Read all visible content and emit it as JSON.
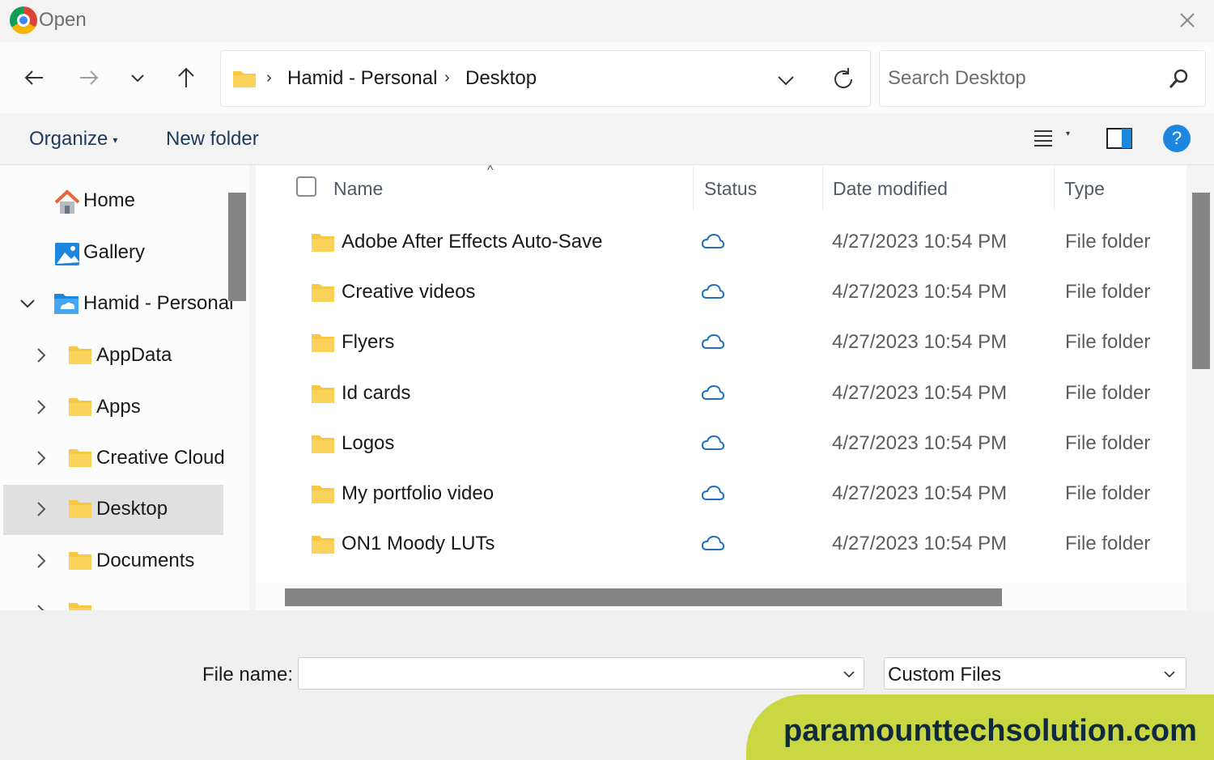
{
  "window": {
    "title": "Open"
  },
  "address": {
    "crumbs": [
      "Hamid - Personal",
      "Desktop"
    ]
  },
  "search": {
    "placeholder": "Search Desktop"
  },
  "toolbar": {
    "organize_label": "Organize",
    "new_folder_label": "New folder",
    "help_label": "?"
  },
  "sidebar": {
    "items": [
      {
        "label": "Home",
        "icon": "home-icon"
      },
      {
        "label": "Gallery",
        "icon": "gallery-icon"
      },
      {
        "label": "Hamid - Personal",
        "icon": "onedrive-folder-icon",
        "expanded": true
      },
      {
        "label": "AppData",
        "icon": "folder-icon"
      },
      {
        "label": "Apps",
        "icon": "folder-icon"
      },
      {
        "label": "Creative Cloud",
        "icon": "folder-icon"
      },
      {
        "label": "Desktop",
        "icon": "folder-icon",
        "selected": true
      },
      {
        "label": "Documents",
        "icon": "folder-icon"
      }
    ]
  },
  "files": {
    "columns": [
      "Name",
      "Status",
      "Date modified",
      "Type"
    ],
    "rows": [
      {
        "name": "Adobe After Effects Auto-Save",
        "status": "cloud-icon",
        "date": "4/27/2023 10:54 PM",
        "type": "File folder"
      },
      {
        "name": "Creative videos",
        "status": "cloud-icon",
        "date": "4/27/2023 10:54 PM",
        "type": "File folder"
      },
      {
        "name": "Flyers",
        "status": "cloud-icon",
        "date": "4/27/2023 10:54 PM",
        "type": "File folder"
      },
      {
        "name": "Id cards",
        "status": "cloud-icon",
        "date": "4/27/2023 10:54 PM",
        "type": "File folder"
      },
      {
        "name": "Logos",
        "status": "cloud-icon",
        "date": "4/27/2023 10:54 PM",
        "type": "File folder"
      },
      {
        "name": "My portfolio video",
        "status": "cloud-icon",
        "date": "4/27/2023 10:54 PM",
        "type": "File folder"
      },
      {
        "name": "ON1 Moody LUTs",
        "status": "cloud-icon",
        "date": "4/27/2023 10:54 PM",
        "type": "File folder"
      }
    ]
  },
  "footer": {
    "file_name_label": "File name:",
    "file_name_value": "",
    "filter_value": "Custom Files"
  },
  "watermark": {
    "text": "paramounttechsolution.com"
  },
  "colors": {
    "accent": "#1d87e0",
    "folder": "#f8c842",
    "cloud": "#1e6fc0",
    "watermark_bg": "#c9d842"
  }
}
